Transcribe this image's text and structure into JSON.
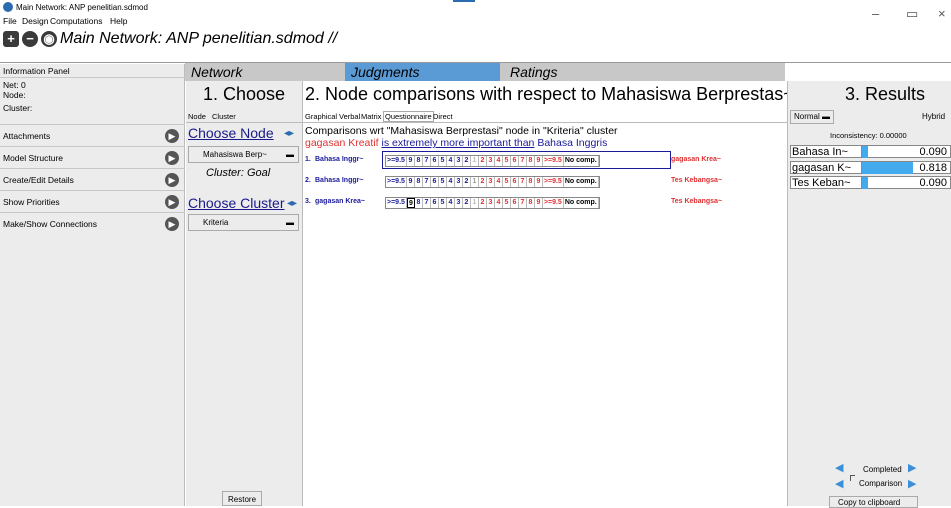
{
  "window": {
    "title": "Main Network: ANP penelitian.sdmod",
    "min": "–",
    "max": "▭",
    "close": "×"
  },
  "menu": [
    "File",
    "Design",
    "Computations",
    "Help"
  ],
  "toolbar": {
    "title": "Main Network: ANP penelitian.sdmod //"
  },
  "header_tabs": {
    "network": "Network",
    "judgments": "Judgments",
    "ratings": "Ratings"
  },
  "info_panel": {
    "title": "Information Panel",
    "net": "Net: 0",
    "node": "Node:",
    "cluster": "Cluster:",
    "items": [
      "Attachments",
      "Model Structure",
      "Create/Edit Details",
      "Show Priorities",
      "Make/Show Connections"
    ]
  },
  "choose": {
    "heading": "1. Choose",
    "tabs": [
      "Node",
      "Cluster"
    ],
    "choose_node": "Choose Node",
    "node_value": "Mahasiswa Berp~",
    "cluster_goal": "Cluster: Goal",
    "choose_cluster": "Choose Cluster",
    "cluster_value": "Kriteria",
    "restore": "Restore"
  },
  "comparisons": {
    "heading": "2. Node comparisons with respect to Mahasiswa Berprestas~",
    "plus": "+",
    "tabs": [
      "Graphical",
      "Verbal",
      "Matrix",
      "Questionnaire",
      "Direct"
    ],
    "caption": "Comparisons wrt \"Mahasiswa Berprestasi\" node in \"Kriteria\" cluster",
    "verbal": {
      "left": "gagasan Kreatif",
      "middle": "is extremely more important than",
      "right": "Bahasa Inggris"
    },
    "scale_left": [
      ">=9.5",
      "9",
      "8",
      "7",
      "6",
      "5",
      "4",
      "3",
      "2",
      "1"
    ],
    "scale_right": [
      "2",
      "3",
      "4",
      "5",
      "6",
      "7",
      "8",
      "9",
      ">=9.5",
      "No comp."
    ],
    "rows": [
      {
        "num": "1.",
        "left": "Bahasa Inggr~",
        "right": "gagasan Krea~"
      },
      {
        "num": "2.",
        "left": "Bahasa Inggr~",
        "right": "Tes Kebangsa~"
      },
      {
        "num": "3.",
        "left": "gagasan Krea~",
        "right": "Tes Kebangsa~"
      }
    ]
  },
  "results": {
    "heading": "3. Results",
    "mode": "Normal",
    "hybrid": "Hybrid",
    "inconsistency": "Inconsistency: 0.00000",
    "rows": [
      {
        "label": "Bahasa In~",
        "value": "0.090",
        "fraction": 0.09
      },
      {
        "label": "gagasan K~",
        "value": "0.818",
        "fraction": 0.818
      },
      {
        "label": "Tes Keban~",
        "value": "0.090",
        "fraction": 0.09
      }
    ],
    "completed": "Completed",
    "comparison": "Comparison",
    "copy": "Copy to clipboard"
  }
}
